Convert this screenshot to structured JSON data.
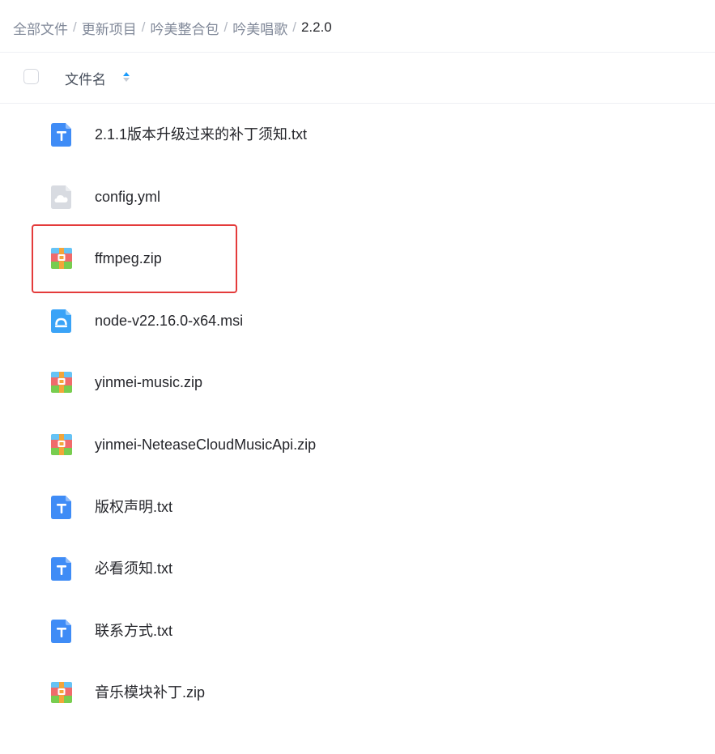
{
  "breadcrumb": [
    {
      "label": "全部文件",
      "current": false
    },
    {
      "label": "更新项目",
      "current": false
    },
    {
      "label": "吟美整合包",
      "current": false
    },
    {
      "label": "吟美唱歌",
      "current": false
    },
    {
      "label": "2.2.0",
      "current": true
    }
  ],
  "breadcrumb_separator": "/",
  "list_header": {
    "column_name": "文件名",
    "select_all_checked": false
  },
  "files": [
    {
      "name": "2.1.1版本升级过来的补丁须知.txt",
      "icon": "txt-file-icon"
    },
    {
      "name": "config.yml",
      "icon": "cloud-file-icon"
    },
    {
      "name": "ffmpeg.zip",
      "icon": "zip-file-icon"
    },
    {
      "name": "node-v22.16.0-x64.msi",
      "icon": "installer-file-icon"
    },
    {
      "name": "yinmei-music.zip",
      "icon": "zip-file-icon"
    },
    {
      "name": "yinmei-NeteaseCloudMusicApi.zip",
      "icon": "zip-file-icon"
    },
    {
      "name": "版权声明.txt",
      "icon": "txt-file-icon"
    },
    {
      "name": "必看须知.txt",
      "icon": "txt-file-icon"
    },
    {
      "name": "联系方式.txt",
      "icon": "txt-file-icon"
    },
    {
      "name": "音乐模块补丁.zip",
      "icon": "zip-file-icon"
    }
  ],
  "colors": {
    "highlight_border": "#e43b3b",
    "sort_arrow_active": "#1a9bfc",
    "sort_arrow_inactive": "#c5cad3",
    "txt_icon": "#3f8cf6",
    "installer_icon": "#3aa3f7",
    "cloud_icon": "#d8dbe1"
  }
}
